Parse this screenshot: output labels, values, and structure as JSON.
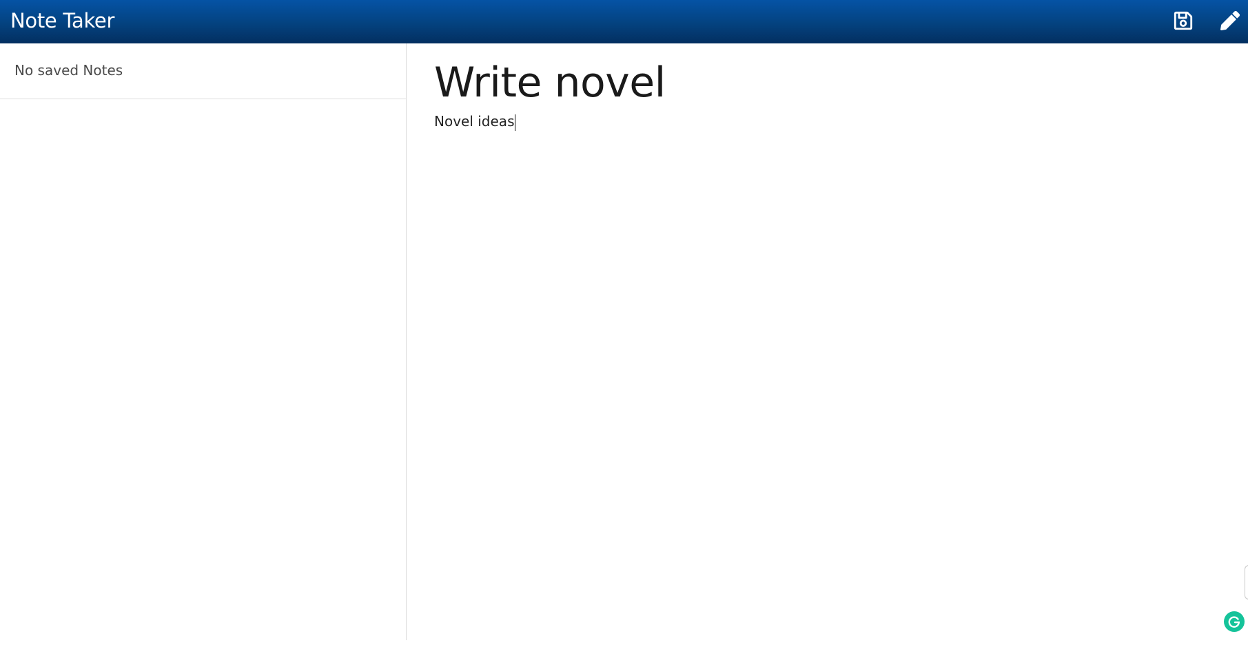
{
  "app": {
    "title": "Note Taker"
  },
  "toolbar": {
    "save_icon": "save-icon",
    "edit_icon": "pencil-icon"
  },
  "sidebar": {
    "empty_message": "No saved Notes"
  },
  "note": {
    "title_value": "Write novel",
    "text_value": "Novel ideas"
  },
  "colors": {
    "navbar_top": "#0553a5",
    "navbar_bottom": "#032f60",
    "grammarly": "#15c39a"
  }
}
